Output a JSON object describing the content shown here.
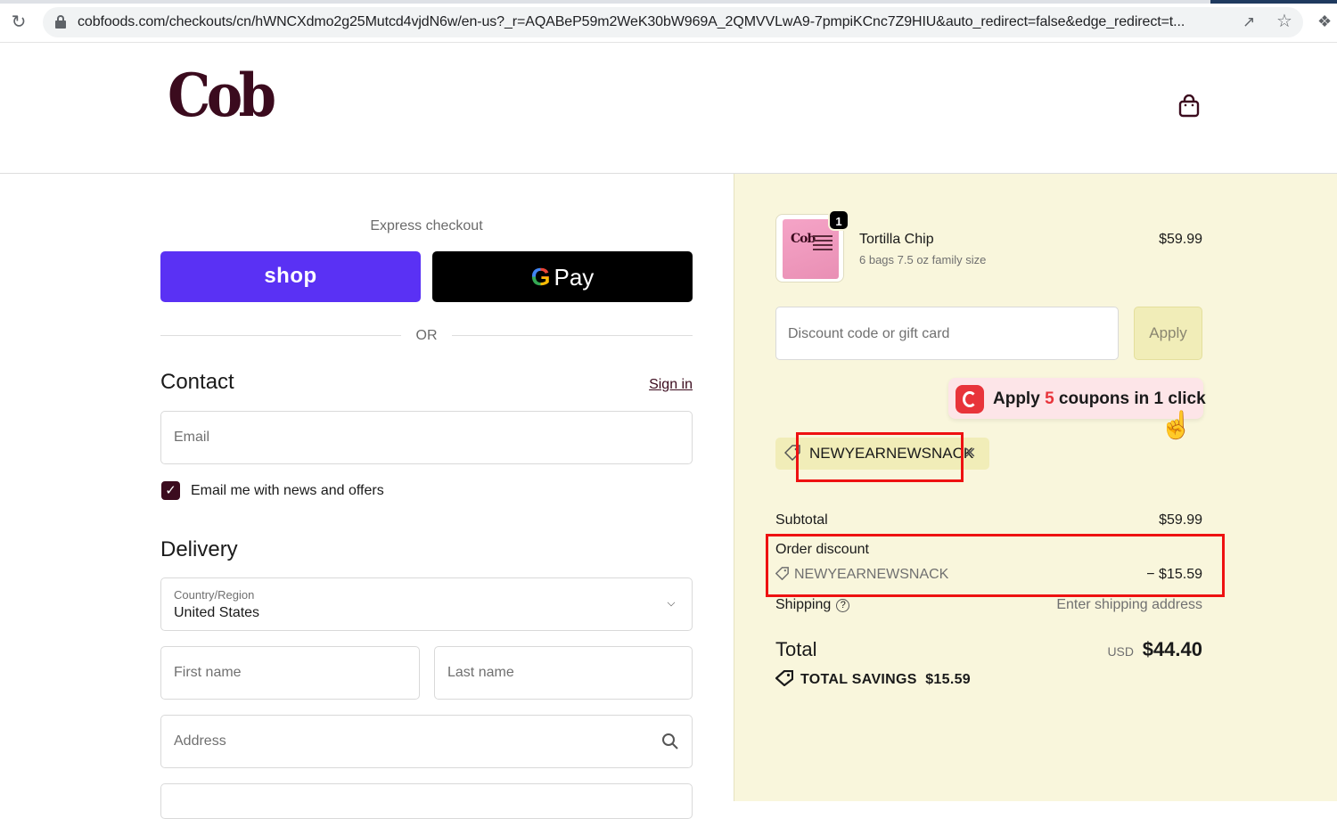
{
  "browser": {
    "url": "cobfoods.com/checkouts/cn/hWNCXdmo2g25Mutcd4vjdN6w/en-us?_r=AQABeP59m2WeK30bW969A_2QMVVLwA9-7pmpiKCnc7Z9HIU&auto_redirect=false&edge_redirect=t..."
  },
  "header": {
    "logo_text": "Cob"
  },
  "express": {
    "title": "Express checkout",
    "shop_label": "shop",
    "gpay_g": "G",
    "gpay_label": "Pay",
    "or_label": "OR"
  },
  "contact": {
    "title": "Contact",
    "signin_label": "Sign in",
    "email_placeholder": "Email",
    "newsletter_label": "Email me with news and offers",
    "newsletter_checked": true
  },
  "delivery": {
    "title": "Delivery",
    "country_label": "Country/Region",
    "country_value": "United States",
    "first_name_placeholder": "First name",
    "last_name_placeholder": "Last name",
    "address_placeholder": "Address"
  },
  "summary": {
    "product": {
      "quantity": "1",
      "name": "Tortilla Chip",
      "variant": "6 bags 7.5 oz family size",
      "price": "$59.99"
    },
    "discount_placeholder": "Discount code or gift card",
    "apply_label": "Apply",
    "coupon_popup": {
      "prefix": "Apply ",
      "count": "5",
      "suffix": " coupons in 1 click"
    },
    "applied_code": "NEWYEARNEWSNACK",
    "subtotal_label": "Subtotal",
    "subtotal_value": "$59.99",
    "order_discount_label": "Order discount",
    "order_discount_code": "NEWYEARNEWSNACK",
    "order_discount_value": "− $15.59",
    "shipping_label": "Shipping",
    "shipping_value": "Enter shipping address",
    "total_label": "Total",
    "currency": "USD",
    "total_value": "$44.40",
    "savings_label": "TOTAL SAVINGS",
    "savings_value": "$15.59"
  },
  "colors": {
    "brand": "#3b0b1e",
    "shop_pay": "#5a31f4",
    "summary_bg": "#f9f6dc",
    "highlight": "#ee1111"
  }
}
